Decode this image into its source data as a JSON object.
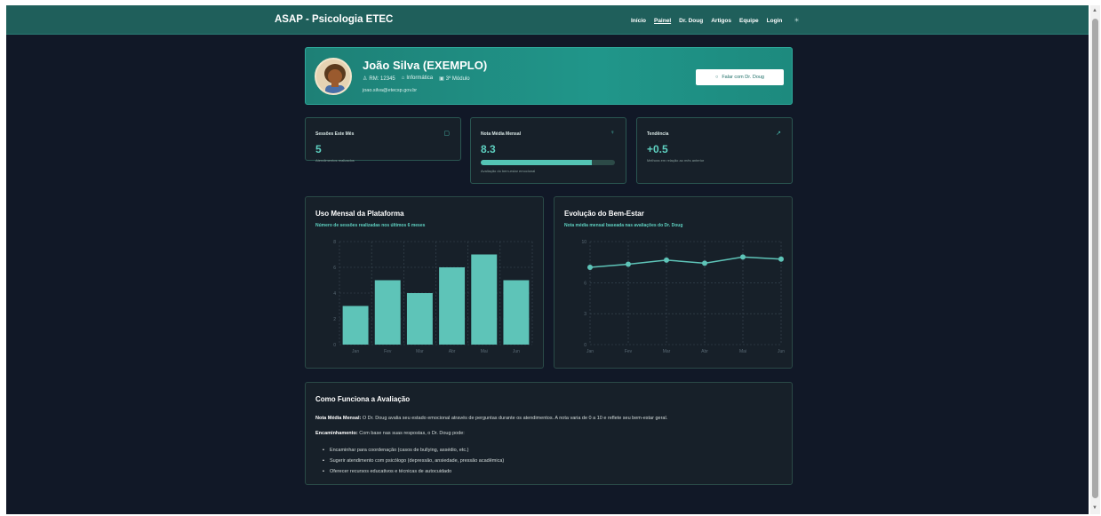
{
  "nav": {
    "brand": "ASAP - Psicologia ETEC",
    "links": [
      "Início",
      "Painel",
      "Dr. Doug",
      "Artigos",
      "Equipe",
      "Login"
    ],
    "active": "Painel",
    "theme_icon": "sun-icon"
  },
  "profile": {
    "name": "João Silva (EXEMPLO)",
    "rm": "RM: 12345",
    "course": "Informática",
    "module": "3º Módulo",
    "email": "joao.silva@etecsp.gov.br",
    "talk_button": "Falar com Dr. Doug"
  },
  "stats": [
    {
      "title": "Sessões Este Mês",
      "icon": "calendar-icon",
      "value": "5",
      "sub": "Atendimentos realizados"
    },
    {
      "title": "Nota Média Mensal",
      "icon": "award-icon",
      "value": "8.3",
      "progress": 0.83,
      "sub": "Avaliação do bem-estar emocional"
    },
    {
      "title": "Tendência",
      "icon": "trending-up-icon",
      "value": "+0.5",
      "sub": "Melhora em relação ao mês anterior"
    }
  ],
  "charts": {
    "usage": {
      "title": "Uso Mensal da Plataforma",
      "subtitle": "Número de sessões realizadas nos últimos 6 meses"
    },
    "wellbeing": {
      "title": "Evolução do Bem-Estar",
      "subtitle": "Nota média mensal baseada nas avaliações do Dr. Doug"
    }
  },
  "chart_data": [
    {
      "type": "bar",
      "title": "Uso Mensal da Plataforma",
      "categories": [
        "Jan",
        "Fev",
        "Mar",
        "Abr",
        "Mai",
        "Jun"
      ],
      "values": [
        3,
        5,
        4,
        6,
        7,
        5
      ],
      "ylim": [
        0,
        8
      ],
      "yticks": [
        0,
        2,
        4,
        6,
        8
      ],
      "grid": true,
      "color": "#5ec4b8"
    },
    {
      "type": "line",
      "title": "Evolução do Bem-Estar",
      "categories": [
        "Jan",
        "Fev",
        "Mar",
        "Abr",
        "Mai",
        "Jun"
      ],
      "values": [
        7.5,
        7.8,
        8.2,
        7.9,
        8.5,
        8.3
      ],
      "ylim": [
        0,
        10
      ],
      "yticks": [
        0,
        3,
        6,
        10
      ],
      "grid": true,
      "color": "#5ec4b8"
    }
  ],
  "info": {
    "title": "Como Funciona a Avaliação",
    "p1_label": "Nota Média Mensal:",
    "p1_text": " O Dr. Doug avalia seu estado emocional através de perguntas durante os atendimentos. A nota varia de 0 a 10 e reflete seu bem-estar geral.",
    "p2_label": "Encaminhamento:",
    "p2_text": " Com base nas suas respostas, o Dr. Doug pode:",
    "items": [
      "Encaminhar para coordenação (casos de bullying, assédio, etc.)",
      "Sugerir atendimento com psicólogo (depressão, ansiedade, pressão acadêmica)",
      "Oferecer recursos educativos e técnicas de autocuidado"
    ]
  }
}
